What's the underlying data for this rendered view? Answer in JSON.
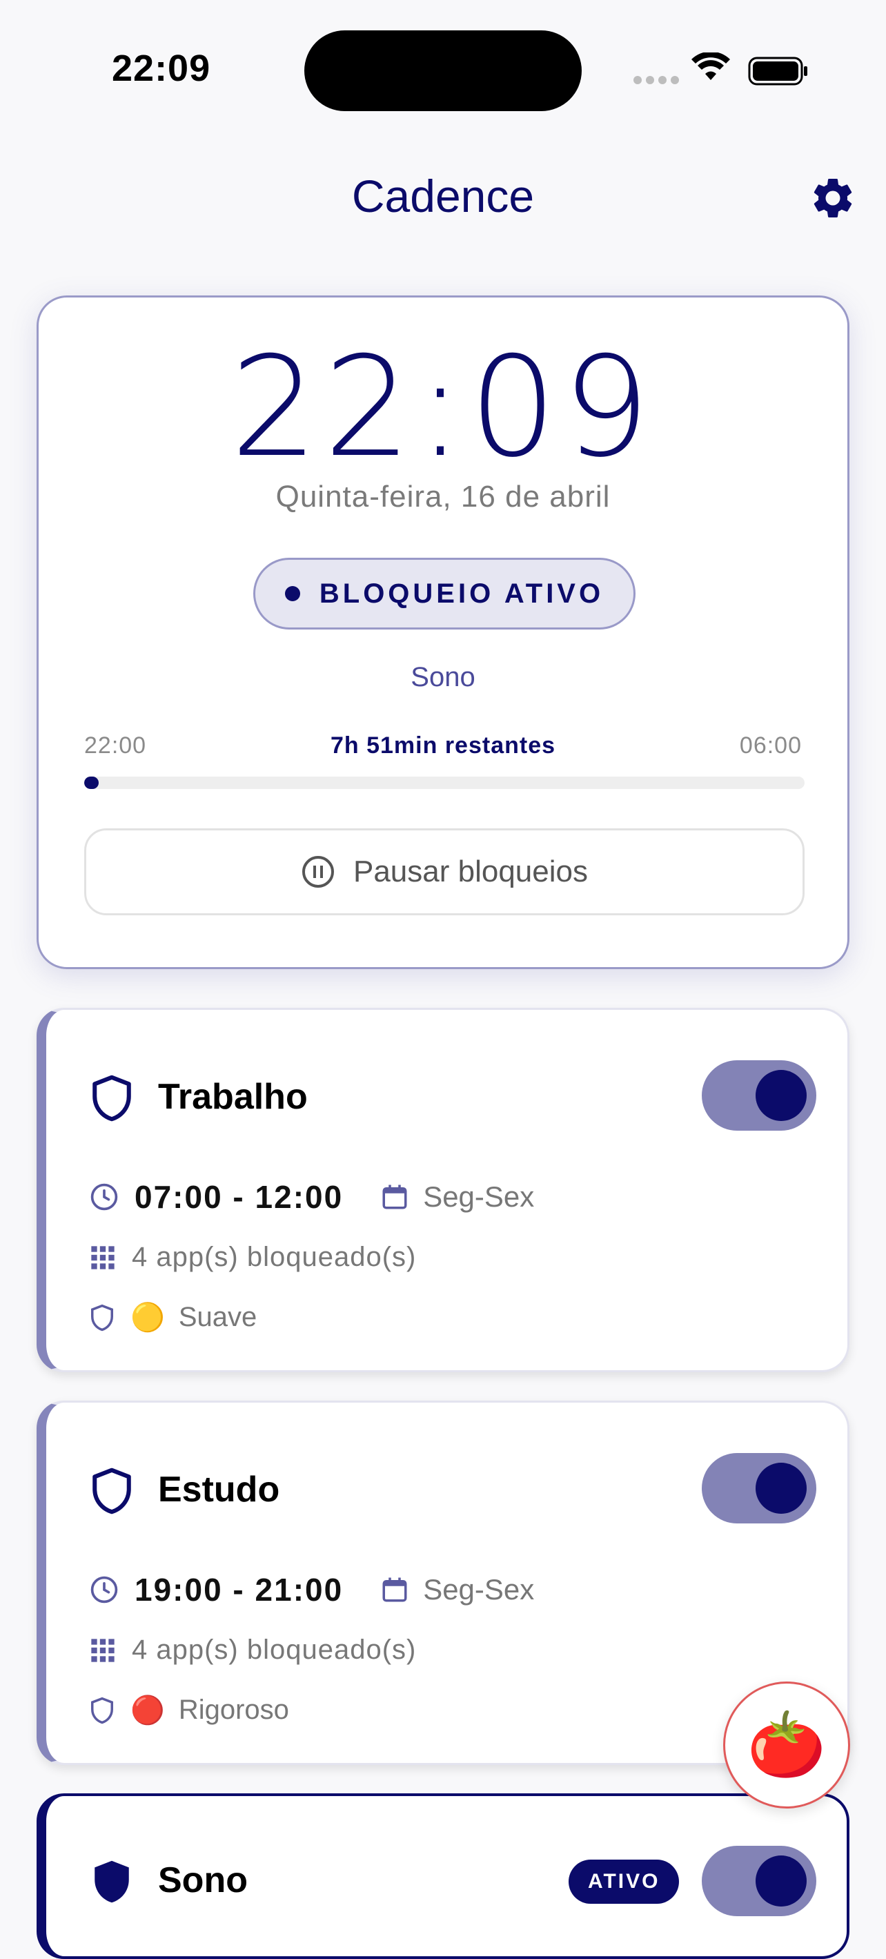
{
  "status_bar": {
    "time": "22:09"
  },
  "header": {
    "title": "Cadence"
  },
  "hero": {
    "clock": "22:09",
    "date": "Quinta-feira, 16 de abril",
    "status_label": "BLOQUEIO ATIVO",
    "schedule_name": "Sono",
    "range_start": "22:00",
    "range_end": "06:00",
    "remaining": "7h 51min restantes",
    "progress_fraction": 0.02,
    "pause_label": "Pausar bloqueios"
  },
  "schedules": [
    {
      "name": "Trabalho",
      "time": "07:00 - 12:00",
      "days": "Seg-Sex",
      "apps": "4 app(s) bloqueado(s)",
      "level_emoji": "🟡",
      "level": "Suave",
      "enabled": true
    },
    {
      "name": "Estudo",
      "time": "19:00 - 21:00",
      "days": "Seg-Sex",
      "apps": "4 app(s) bloqueado(s)",
      "level_emoji": "🔴",
      "level": "Rigoroso",
      "enabled": true
    },
    {
      "name": "Sono",
      "badge": "ATIVO",
      "enabled": true
    }
  ],
  "fab": {
    "emoji": "🍅"
  },
  "colors": {
    "primary": "#0b0b6a",
    "accent_soft": "#8383b6",
    "background": "#f8f8fa"
  }
}
